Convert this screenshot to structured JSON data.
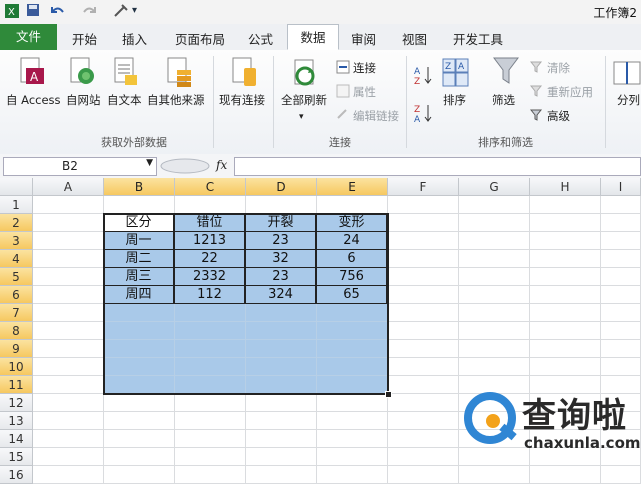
{
  "window": {
    "title": "工作簿2"
  },
  "qat": {
    "more": "▾",
    "sep": "|"
  },
  "tabs": [
    "文件",
    "开始",
    "插入",
    "页面布局",
    "公式",
    "数据",
    "审阅",
    "视图",
    "开发工具"
  ],
  "active_tab": "数据",
  "ribbon": {
    "get_external": {
      "label": "获取外部数据",
      "items": [
        "自 Access",
        "自网站",
        "自文本",
        "自其他来源"
      ]
    },
    "existing": {
      "label": "现有连接"
    },
    "connections": {
      "label": "连接",
      "refresh_all": "全部刷新",
      "connections": "连接",
      "properties": "属性",
      "edit_links": "编辑链接"
    },
    "sort_filter": {
      "label": "排序和筛选",
      "sort": "排序",
      "filter": "筛选",
      "clear": "清除",
      "reapply": "重新应用",
      "advanced": "高级"
    },
    "split": {
      "label": "分列"
    }
  },
  "formula_bar": {
    "name_box": "B2",
    "fx": "fx",
    "value": ""
  },
  "columns": [
    "A",
    "B",
    "C",
    "D",
    "E",
    "F",
    "G",
    "H",
    "I"
  ],
  "rows": [
    "1",
    "2",
    "3",
    "4",
    "5",
    "6",
    "7",
    "8",
    "9",
    "10",
    "11",
    "12",
    "13",
    "14",
    "15",
    "16"
  ],
  "table": {
    "headers": [
      "区分",
      "错位",
      "开裂",
      "变形"
    ],
    "rows": [
      [
        "周一",
        "1213",
        "23",
        "24"
      ],
      [
        "周二",
        "22",
        "32",
        "6"
      ],
      [
        "周三",
        "2332",
        "23",
        "756"
      ],
      [
        "周四",
        "112",
        "324",
        "65"
      ]
    ]
  },
  "selection": {
    "range": "B2:E11"
  },
  "colors": {
    "file_tab": "#2f8a3a",
    "selection": "#a9c9e9",
    "header_highlight": "#f6c860"
  },
  "watermark": {
    "cn": "查询啦",
    "en": "chaxunla.com"
  }
}
